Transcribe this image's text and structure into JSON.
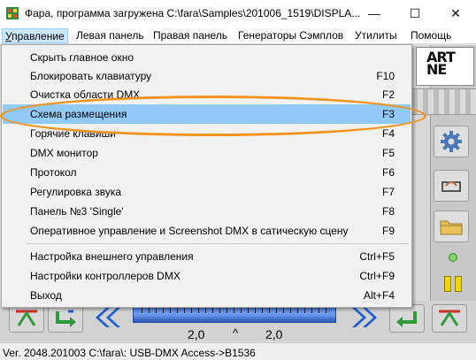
{
  "window": {
    "title": "Фара, программа загружена C:\\fara\\Samples\\201006_1519\\DISPLA...",
    "minimize": "—",
    "maximize": "☐",
    "close": "✕"
  },
  "menubar": {
    "items": [
      {
        "label": "Управление",
        "hot": "У",
        "rest": "правление"
      },
      {
        "label": "Левая панель",
        "hot": "",
        "rest": "Левая панель"
      },
      {
        "label": "Правая панель",
        "hot": "",
        "rest": "Правая панель"
      },
      {
        "label": "Генераторы Сэмплов",
        "hot": "",
        "rest": "Генераторы Сэмплов"
      },
      {
        "label": "Утилиты",
        "hot": "",
        "rest": "Утилиты"
      },
      {
        "label": "Помощь",
        "hot": "",
        "rest": "Помощь"
      }
    ]
  },
  "dropdown": {
    "items": [
      {
        "label": "Скрыть главное окно",
        "shortcut": ""
      },
      {
        "label": "Блокировать клавиатуру",
        "shortcut": "F10"
      },
      {
        "label": "Очистка области DMX",
        "shortcut": "F2"
      },
      {
        "label": "Схема размещения",
        "shortcut": "F3"
      },
      {
        "label": "Горячие клавиши",
        "shortcut": "F4"
      },
      {
        "label": "DMX монитор",
        "shortcut": "F5"
      },
      {
        "label": "Протокол",
        "shortcut": "F6"
      },
      {
        "label": "Регулировка звука",
        "shortcut": "F7"
      },
      {
        "label": "Панель №3 'Single'",
        "shortcut": "F8"
      },
      {
        "label": "Оперативное управление и Screenshot DMX в сатическую сцену",
        "shortcut": "F9"
      },
      {
        "label": "Настройка внешнего управления",
        "shortcut": "Ctrl+F5"
      },
      {
        "label": "Настройки контроллеров DMX",
        "shortcut": "Ctrl+F9"
      },
      {
        "label": "Выход",
        "shortcut": "Alt+F4"
      }
    ],
    "highlighted_index": 3
  },
  "logo": {
    "line1": "ART",
    "line2": "NE"
  },
  "fader": {
    "left_value": "2,0",
    "caret": "^",
    "right_value": "2,0"
  },
  "statusbar": {
    "text": "Ver. 2048.201003 C:\\fara\\: USB-DMX Access->B1536"
  },
  "colors": {
    "menu_highlight": "#91c9f7",
    "annotation": "#f2941e",
    "fader_blue": "#3b6fd4",
    "arrow_green": "#2f9a3a",
    "arrow_red": "#d0322a",
    "chevron_blue": "#1f5fd6"
  }
}
